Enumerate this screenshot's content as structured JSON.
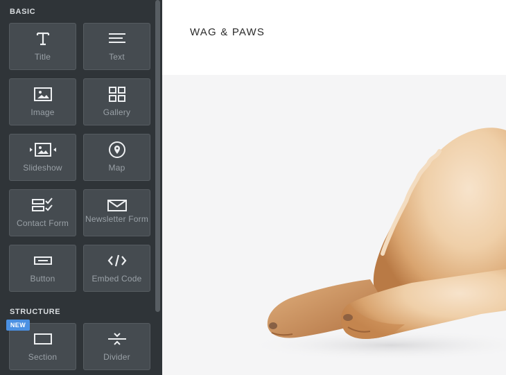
{
  "sidebar": {
    "sections": [
      {
        "label": "BASIC"
      },
      {
        "label": "STRUCTURE"
      }
    ],
    "basic_items": [
      {
        "label": "Title",
        "icon": "title-icon"
      },
      {
        "label": "Text",
        "icon": "text-icon"
      },
      {
        "label": "Image",
        "icon": "image-icon"
      },
      {
        "label": "Gallery",
        "icon": "gallery-icon"
      },
      {
        "label": "Slideshow",
        "icon": "slideshow-icon"
      },
      {
        "label": "Map",
        "icon": "map-pin-icon"
      },
      {
        "label": "Contact Form",
        "icon": "contact-form-icon"
      },
      {
        "label": "Newsletter Form",
        "icon": "newsletter-icon"
      },
      {
        "label": "Button",
        "icon": "button-icon"
      },
      {
        "label": "Embed Code",
        "icon": "embed-code-icon"
      }
    ],
    "structure_items": [
      {
        "label": "Section",
        "icon": "section-icon"
      },
      {
        "label": "Divider",
        "icon": "divider-icon"
      }
    ],
    "new_badge": "NEW",
    "colors": {
      "background": "#2f3438",
      "tile": "#454b50",
      "badge": "#4a90e2"
    }
  },
  "canvas": {
    "site_title": "WAG & PAWS",
    "hero_image": "golden-puppy-photo"
  }
}
